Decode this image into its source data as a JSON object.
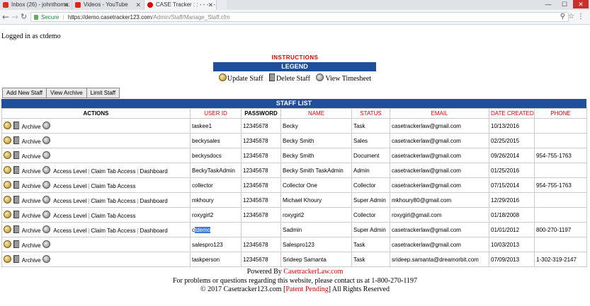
{
  "browser": {
    "tabs": [
      {
        "title": "Inbox (26) - johnthoma:",
        "favicon_color": "#d93025"
      },
      {
        "title": "Videos - YouTube",
        "favicon_color": "#e62117"
      },
      {
        "title": "CASE Tracker : : - - - - - - -",
        "favicon_color": "#e00000"
      }
    ],
    "url_secure_label": "Secure",
    "url_host": "https://demo.casetracker123.com",
    "url_path": "/Admin/Staff/Manage_Staff.cfm",
    "window_controls": [
      "—",
      "☐",
      "✕"
    ]
  },
  "logged_in": "Logged in as ctdemo",
  "instructions_title": "INSTRUCTIONS",
  "legend": {
    "title": "LEGEND",
    "items": [
      "Update Staff",
      "Delete Staff",
      "View Timesheet"
    ]
  },
  "subnav": [
    "Add New Staff",
    "View Archive",
    "Limit Staff"
  ],
  "staff_list": {
    "title": "STAFF LIST",
    "headers": [
      "ACTIONS",
      "USER ID",
      "PASSWORD",
      "NAME",
      "STATUS",
      "EMAIL",
      "DATE CREATED",
      "PHONE"
    ],
    "action_labels": {
      "archive": "Archive",
      "access_level": "Access Level",
      "claim_tab_access": "Claim Tab Access",
      "dashboard": "Dashboard"
    },
    "rows": [
      {
        "user_id": "taskee1",
        "password": "12345678",
        "name": "Becky",
        "status": "Task",
        "email": "casetrackerlaw@gmail.com",
        "date_created": "10/13/2016",
        "phone": ""
      },
      {
        "user_id": "beckysales",
        "password": "12345678",
        "name": "Becky Smith",
        "status": "Sales",
        "email": "casetrackerlaw@gmail.com",
        "date_created": "02/25/2015",
        "phone": ""
      },
      {
        "user_id": "beckysdocs",
        "password": "12345678",
        "name": "Becky Smith",
        "status": "Document",
        "email": "casetrackerlaw@gmail.com",
        "date_created": "09/26/2014",
        "phone": "954-755-1763"
      },
      {
        "user_id": "BeckyTaskAdmin",
        "password": "12345678",
        "name": "Becky Smith TaskAdmin",
        "status": "Admin",
        "email": "casetrackerlaw@gmail.com",
        "date_created": "01/25/2016",
        "phone": ""
      },
      {
        "user_id": "collector",
        "password": "12345678",
        "name": "Collector One",
        "status": "Collector",
        "email": "casetrackerlaw@gmail.com",
        "date_created": "07/15/2014",
        "phone": "954-755-1763"
      },
      {
        "user_id": "mkhoury",
        "password": "12345678",
        "name": "Michael Khoury",
        "status": "Super Admin",
        "email": "mkhoury80@gmail.com",
        "date_created": "12/29/2016",
        "phone": ""
      },
      {
        "user_id": "roxygirl2",
        "password": "12345678",
        "name": "roxygirl2",
        "status": "Collector",
        "email": "roxygirl@gmail.com",
        "date_created": "01/18/2008",
        "phone": ""
      },
      {
        "user_id_plain": "c",
        "user_id_selected": "tdemo",
        "password": "",
        "name": "Sadmin",
        "status": "Super Admin",
        "email": "casetrackerlaw@gmail.com",
        "date_created": "01/01/2012",
        "phone": "800-270-1197"
      },
      {
        "user_id": "salespro123",
        "password": "12345678",
        "name": "Salespro123",
        "status": "Task",
        "email": "casetrackerlaw@gmail.com",
        "date_created": "10/03/2013",
        "phone": ""
      },
      {
        "user_id": "taskperson",
        "password": "12345678",
        "name": "Srideep Samanta",
        "status": "Task",
        "email": "srideep.samanta@dreamorbit.com",
        "date_created": "07/09/2013",
        "phone": "1-302-319-2147"
      }
    ]
  },
  "footer": {
    "powered_by": "Powered By",
    "powered_link": "CasetrackerLaw.com",
    "contact": "For problems or questions regarding this website, please contact us at 1-800-270-1197",
    "copyright_pre": "© 2017 Casetracker123.com [",
    "patent": "Patent Pending",
    "copyright_post": "] All Rights Reserved"
  }
}
